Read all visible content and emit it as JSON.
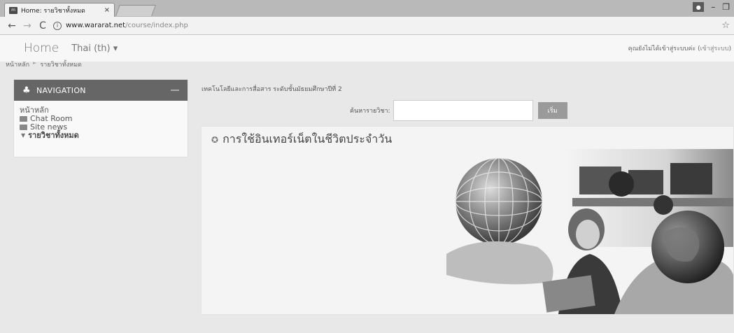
{
  "browser": {
    "tab_title": "Home: รายวิชาทั้งหมด",
    "tab_close": "×",
    "favicon": "m",
    "url_host": "www.wararat.net",
    "url_path": "/course/index.php",
    "back": "←",
    "forward": "→",
    "reload": "C",
    "info": "i",
    "star": "☆",
    "window_controls": {
      "minimize": "–",
      "restore": "❐"
    }
  },
  "header": {
    "brand": "Home",
    "language": "Thai (th) ▾",
    "login_text": "คุณยังไม่ได้เข้าสู่ระบบค่ะ (",
    "login_link": "เข้าสู่ระบบ",
    "login_close": ")"
  },
  "breadcrumb": {
    "home": "หน้าหลัก",
    "sep": "►",
    "current": "รายวิชาทั้งหมด"
  },
  "navigation": {
    "title": "NAVIGATION",
    "home": "หน้าหลัก",
    "chat": "Chat Room",
    "news": "Site news",
    "all_courses": "รายวิชาทั้งหมด"
  },
  "main": {
    "category": "เทคโนโลยีและการสื่อสาร ระดับชั้นมัธยมศึกษาปีที่ 2",
    "search_label": "ค้นหารายวิชา:",
    "search_value": "",
    "search_button": "เริ่ม",
    "course_title": "การใช้อินเทอร์เน็ตในชีวิตประจำวัน"
  },
  "icons": {
    "sitemap": "sitemap-icon",
    "folder": "folder-icon",
    "course": "course-icon"
  }
}
